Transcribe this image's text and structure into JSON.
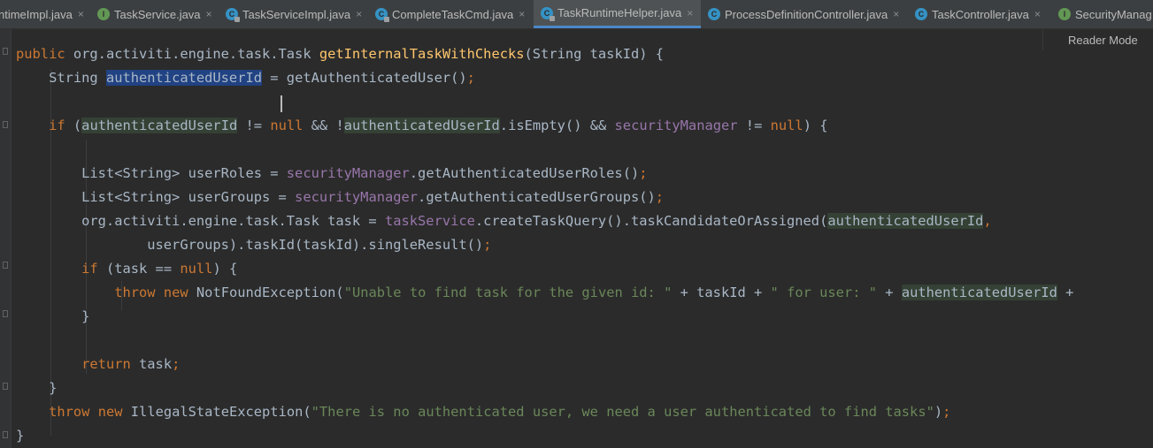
{
  "tabs": [
    {
      "label": "ntimeImpl.java",
      "icon": "class-annotated-icon",
      "active": false
    },
    {
      "label": "TaskService.java",
      "icon": "interface-icon",
      "active": false
    },
    {
      "label": "TaskServiceImpl.java",
      "icon": "class-annotated-icon",
      "active": false
    },
    {
      "label": "CompleteTaskCmd.java",
      "icon": "class-annotated-icon",
      "active": false
    },
    {
      "label": "TaskRuntimeHelper.java",
      "icon": "class-annotated-icon",
      "active": true
    },
    {
      "label": "ProcessDefinitionController.java",
      "icon": "class-icon",
      "active": false
    },
    {
      "label": "TaskController.java",
      "icon": "class-icon",
      "active": false
    },
    {
      "label": "SecurityManag",
      "icon": "interface-icon",
      "active": false
    }
  ],
  "tab_close_glyph": "×",
  "reader_mode": "Reader Mode",
  "code": {
    "l1_kw": "public",
    "l1_a": " org.activiti.engine.task.Task ",
    "l1_fn": "getInternalTaskWithChecks",
    "l1_b": "(String taskId) {",
    "l2_a": "    String ",
    "l2_sel": "authenticatedUserId",
    "l2_b": " = getAuthenticatedUser()",
    "l2_semi": ";",
    "l3_indent": "    ",
    "l3_if": "if",
    "l3_a": " (",
    "l3_var1": "authenticatedUserId",
    "l3_b": " != ",
    "l3_null1": "null",
    "l3_c": " && !",
    "l3_var2": "authenticatedUserId",
    "l3_d": ".isEmpty() && ",
    "l3_field": "securityManager",
    "l3_e": " != ",
    "l3_null2": "null",
    "l3_f": ") {",
    "l4_a": "        List<String> userRoles = ",
    "l4_field": "securityManager",
    "l4_b": ".getAuthenticatedUserRoles()",
    "l4_semi": ";",
    "l5_a": "        List<String> userGroups = ",
    "l5_field": "securityManager",
    "l5_b": ".getAuthenticatedUserGroups()",
    "l5_semi": ";",
    "l6_a": "        org.activiti.engine.task.Task task = ",
    "l6_field": "taskService",
    "l6_b": ".createTaskQuery().taskCandidateOrAssigned(",
    "l6_var": "authenticatedUserId",
    "l6_comma": ",",
    "l7_a": "                userGroups).taskId(taskId).singleResult()",
    "l7_semi": ";",
    "l8_indent": "        ",
    "l8_if": "if",
    "l8_a": " (task == ",
    "l8_null": "null",
    "l8_b": ") {",
    "l9_indent": "            ",
    "l9_throw": "throw",
    "l9_sp": " ",
    "l9_new": "new",
    "l9_a": " NotFoundException(",
    "l9_str1": "\"Unable to find task for the given id: \"",
    "l9_b": " + taskId + ",
    "l9_str2": "\" for user: \"",
    "l9_c": " + ",
    "l9_var": "authenticatedUserId",
    "l9_d": " +",
    "l10": "        }",
    "l12_indent": "        ",
    "l12_return": "return",
    "l12_a": " task",
    "l12_semi": ";",
    "l13": "    }",
    "l14_indent": "    ",
    "l14_throw": "throw",
    "l14_sp": " ",
    "l14_new": "new",
    "l14_a": " IllegalStateException(",
    "l14_str": "\"There is no authenticated user, we need a user authenticated to find tasks\"",
    "l14_b": ")",
    "l14_semi": ";",
    "l15": "}"
  },
  "colors": {
    "background": "#2b2b2b",
    "keyword": "#cc7832",
    "method": "#ffc66d",
    "field": "#9876aa",
    "string": "#6a8759",
    "text": "#a9b7c6",
    "selection": "#214283",
    "usage_highlight": "#344134",
    "active_tab_underline": "#4a88c7"
  }
}
